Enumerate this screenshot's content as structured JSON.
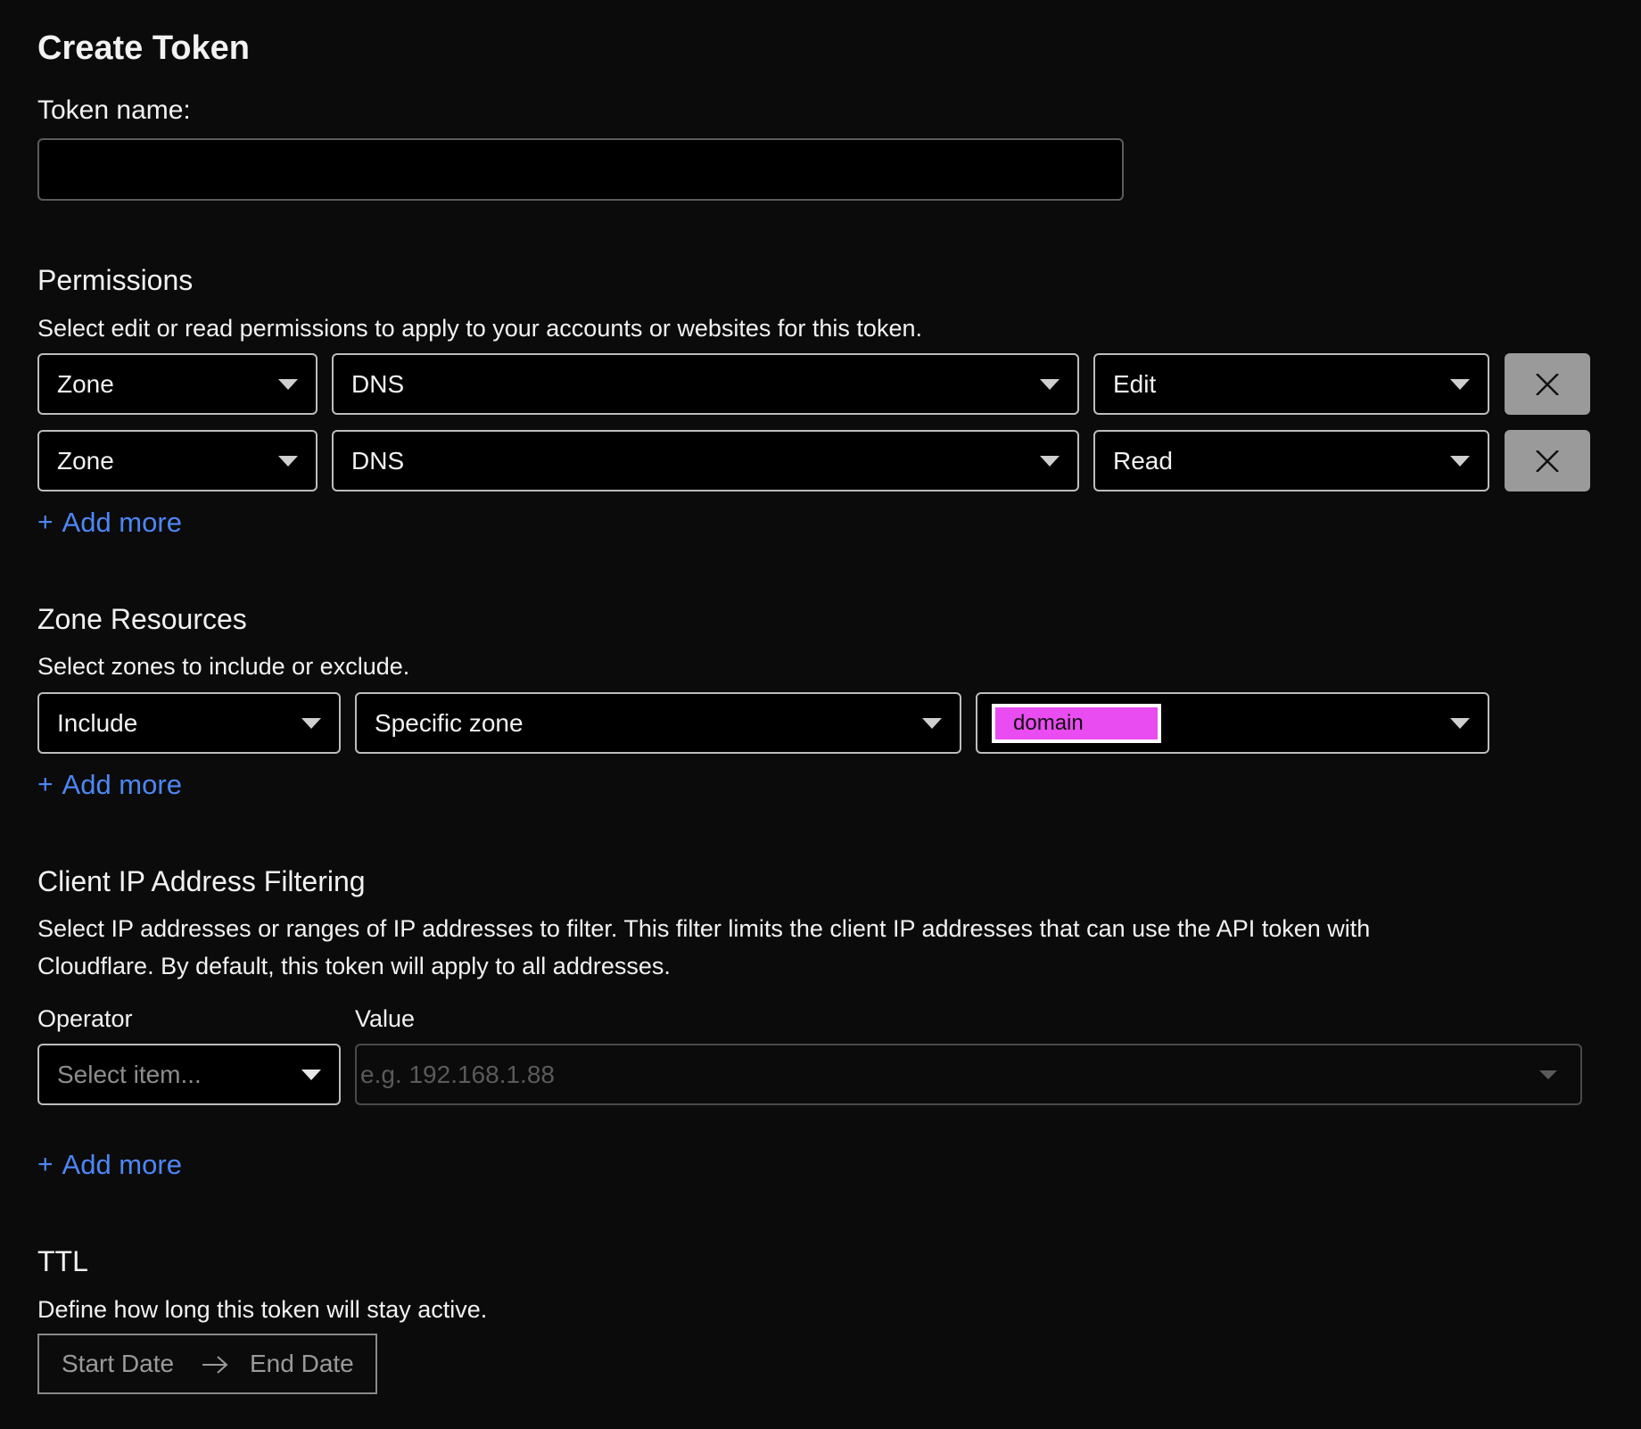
{
  "page": {
    "title": "Create Token"
  },
  "token_name": {
    "label": "Token name:",
    "value": "",
    "placeholder": ""
  },
  "permissions": {
    "title": "Permissions",
    "description": "Select edit or read permissions to apply to your accounts or websites for this token.",
    "rows": [
      {
        "scope": "Zone",
        "resource": "DNS",
        "access": "Edit"
      },
      {
        "scope": "Zone",
        "resource": "DNS",
        "access": "Read"
      }
    ],
    "add_more": "Add more",
    "remove_icon": "close-icon"
  },
  "zone_resources": {
    "title": "Zone Resources",
    "description": "Select zones to include or exclude.",
    "include": "Include",
    "zone_type": "Specific zone",
    "zone_value": "domain",
    "add_more": "Add more"
  },
  "ip_filtering": {
    "title": "Client IP Address Filtering",
    "description_line1": "Select IP addresses or ranges of IP addresses to filter. This filter limits the client IP addresses that can use the API token with",
    "description_line2": "Cloudflare. By default, this token will apply to all addresses.",
    "operator_label": "Operator",
    "value_label": "Value",
    "operator_placeholder": "Select item...",
    "value_placeholder": "e.g. 192.168.1.88",
    "add_more": "Add more"
  },
  "ttl": {
    "title": "TTL",
    "description": "Define how long this token will stay active.",
    "start_placeholder": "Start Date",
    "end_placeholder": "End Date",
    "arrow_icon": "arrow-right-icon"
  },
  "colors": {
    "background": "#0b0b0b",
    "link": "#4d86f5",
    "chip_highlight": "#e94cf0",
    "remove_button": "#9a9a9a"
  }
}
